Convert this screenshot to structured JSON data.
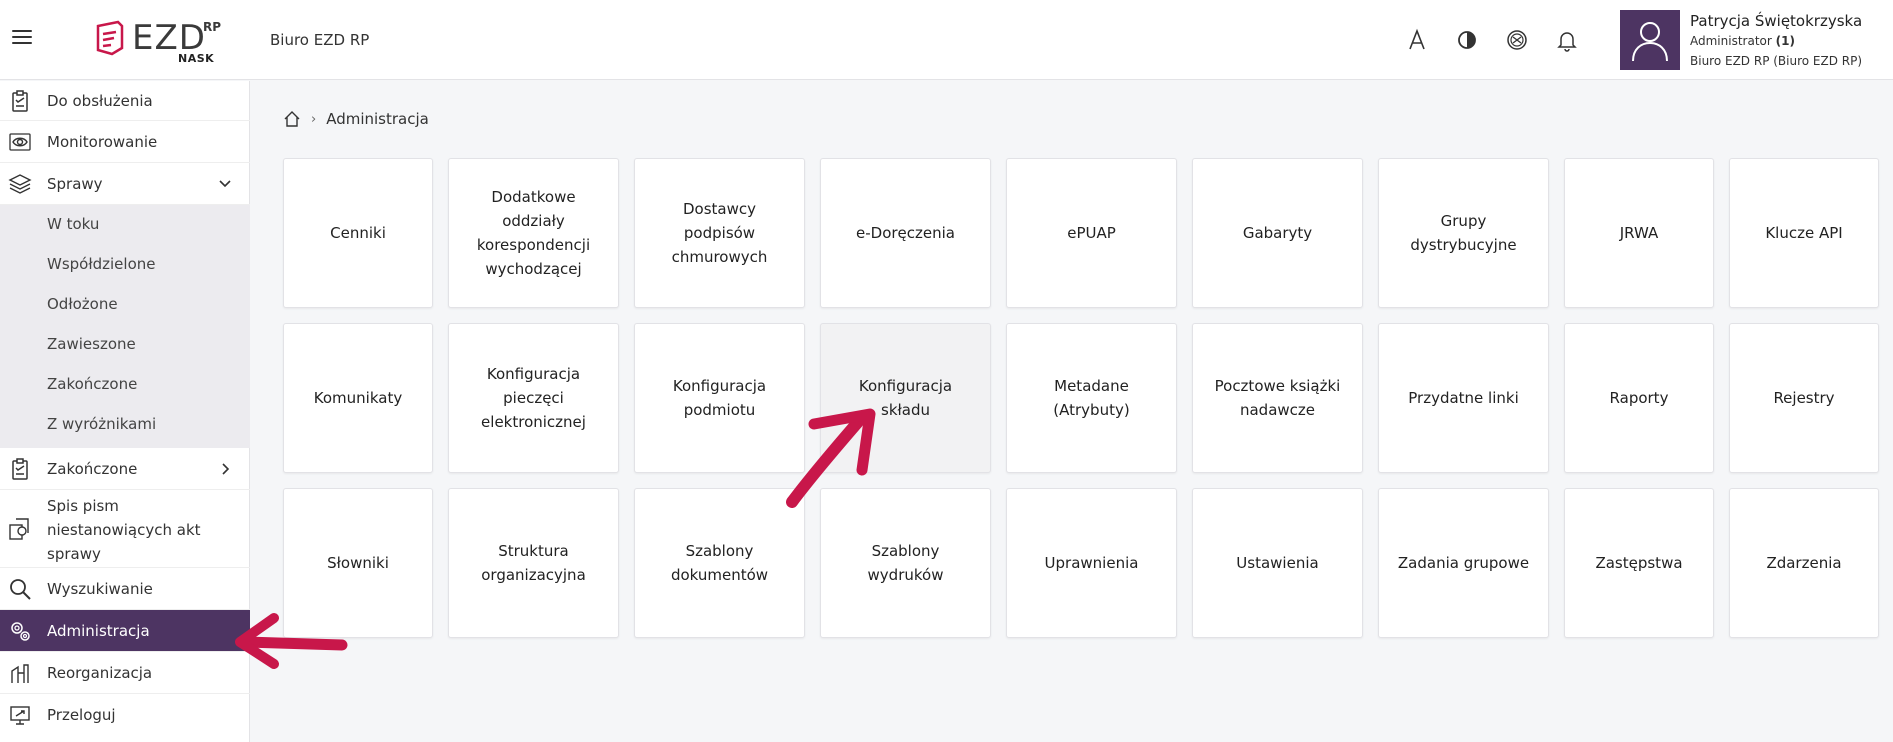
{
  "header": {
    "logo_text": "EZD",
    "logo_rp": "RP",
    "logo_nask": "NASK",
    "org_title": "Biuro EZD RP",
    "icons": [
      "font-size-icon",
      "contrast-icon",
      "accessibility-icon",
      "bell-icon"
    ]
  },
  "user": {
    "name": "Patrycja Świętokrzyska",
    "role_label": "Administrator",
    "role_count": "(1)",
    "org": "Biuro EZD RP (Biuro EZD RP)"
  },
  "sidebar": {
    "items": [
      {
        "label": "Do obsłużenia",
        "icon": "clipboard-check-icon"
      },
      {
        "label": "Monitorowanie",
        "icon": "eye-icon"
      },
      {
        "label": "Sprawy",
        "icon": "layers-icon"
      },
      {
        "label": "Zakończone",
        "icon": "clipboard-check-icon"
      },
      {
        "label": "Spis pism niestanowiących akt sprawy",
        "line1": "Spis pism",
        "line2": "niestanowiących akt",
        "line3": "sprawy",
        "icon": "documents-icon"
      },
      {
        "label": "Wyszukiwanie",
        "icon": "search-icon"
      },
      {
        "label": "Administracja",
        "icon": "gears-icon"
      },
      {
        "label": "Reorganizacja",
        "icon": "reorg-icon"
      },
      {
        "label": "Przeloguj",
        "icon": "relog-icon"
      }
    ],
    "sub_items": [
      "W toku",
      "Współdzielone",
      "Odłożone",
      "Zawieszone",
      "Zakończone",
      "Z wyróżnikami"
    ]
  },
  "breadcrumb": {
    "current": "Administracja"
  },
  "tiles": {
    "row1": [
      "Cenniki",
      "Dodatkowe oddziały korespondencji wychodzącej",
      "Dostawcy podpisów chmurowych",
      "e-Doręczenia",
      "ePUAP",
      "Gabaryty",
      "Grupy dystrybucyjne",
      "JRWA",
      "Klucze API"
    ],
    "row2": [
      "Komunikaty",
      "Konfiguracja pieczęci elektronicznej",
      "Konfiguracja podmiotu",
      "Konfiguracja składu",
      "Metadane (Atrybuty)",
      "Pocztowe książki nadawcze",
      "Przydatne linki",
      "Raporty",
      "Rejestry"
    ],
    "row3": [
      "Słowniki",
      "Struktura organizacyjna",
      "Szablony dokumentów",
      "Szablony wydruków",
      "Uprawnienia",
      "Ustawienia",
      "Zadania grupowe",
      "Zastępstwa",
      "Zdarzenia"
    ]
  },
  "colors": {
    "accent": "#4d3462",
    "annotation_arrow": "#c8174a"
  }
}
